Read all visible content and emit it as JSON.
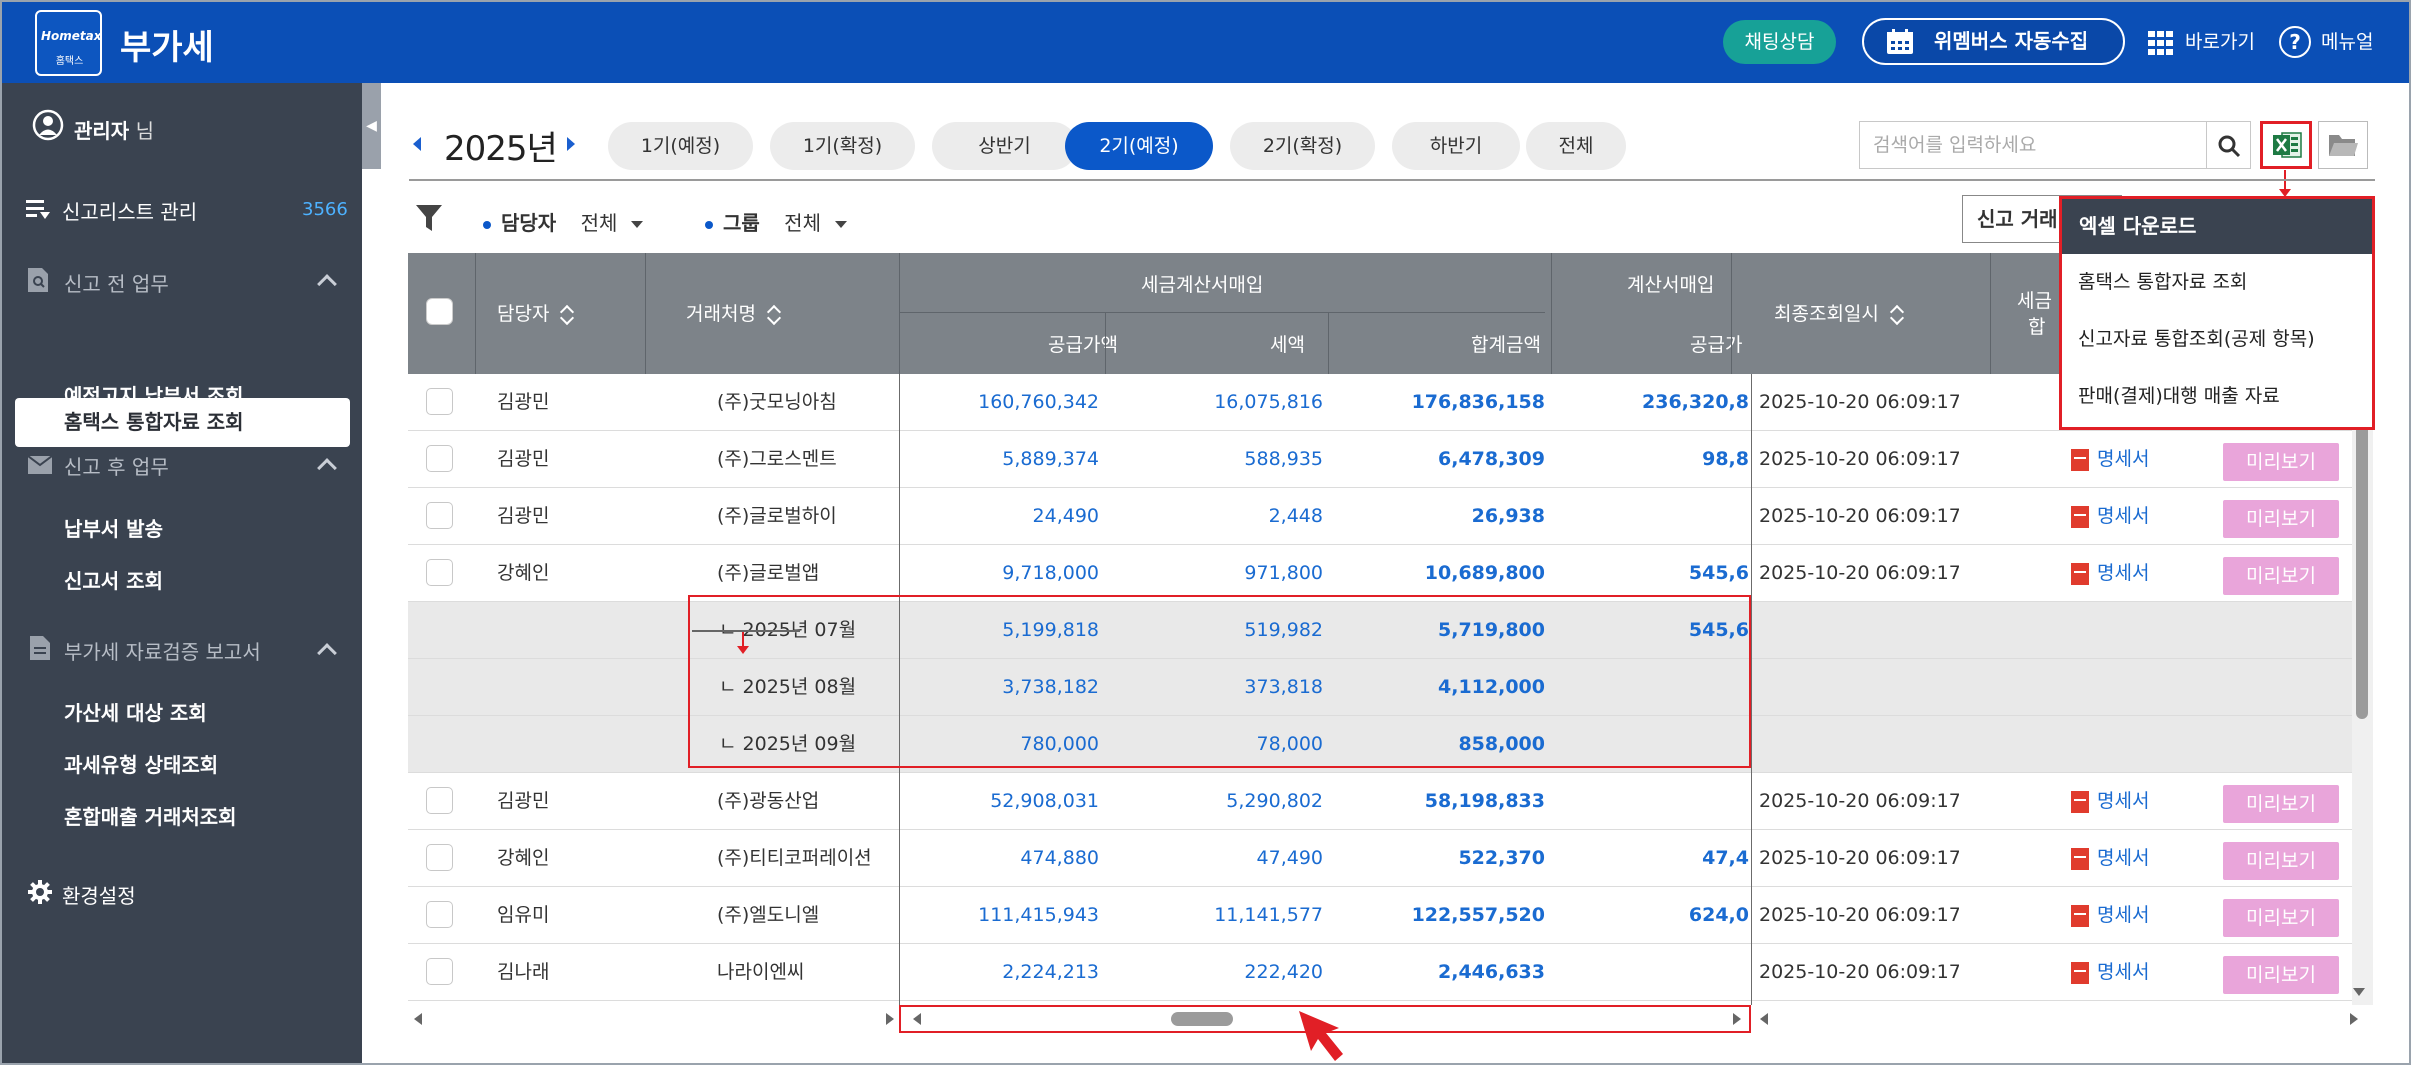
{
  "header": {
    "logo_line1": "Hometax",
    "logo_line2": "홈택스",
    "title": "부가세",
    "chat_label": "채팅상담",
    "wemake_label": "위멤버스 자동수집",
    "shortcut_label": "바로가기",
    "menu_label": "메뉴얼",
    "help_glyph": "?"
  },
  "sidebar": {
    "user_name": "관리자",
    "user_suffix": "님",
    "report_list": {
      "label": "신고리스트 관리",
      "count": "3566"
    },
    "pre_section": "신고 전 업무",
    "pre_items": [
      "홈택스 통합자료 조회",
      "예정고지 납부서 조회"
    ],
    "post_section": "신고 후 업무",
    "post_items": [
      "납부서 발송",
      "신고서 조회"
    ],
    "verify_section": "부가세 자료검증 보고서",
    "verify_items": [
      "가산세 대상 조회",
      "과세유형 상태조회",
      "혼합매출 거래처조회"
    ],
    "settings": "환경설정",
    "collapse_glyph": "◀"
  },
  "toolbar": {
    "year": "2025년",
    "periods": [
      "1기(예정)",
      "1기(확정)",
      "상반기",
      "2기(예정)",
      "2기(확정)",
      "하반기",
      "전체"
    ],
    "active_period": "2기(예정)",
    "search_placeholder": "검색어를 입력하세요",
    "manager_label": "담당자",
    "manager_value": "전체",
    "group_label": "그룹",
    "group_value": "전체",
    "report_btn": "신고 거래"
  },
  "dropdown": {
    "title": "엑셀 다운로드",
    "items": [
      "홈택스 통합자료 조회",
      "신고자료 통합조회(공제 항목)",
      "판매(결제)대행 매출 자료"
    ]
  },
  "table": {
    "headers": {
      "manager": "담당자",
      "client": "거래처명",
      "tax_invoice_group": "세금계산서매입",
      "supply": "공급가액",
      "tax": "세액",
      "total": "합계금액",
      "invoice_group": "계산서매입",
      "invoice_supply": "공급가",
      "last_query": "최종조회일시",
      "tax_col_line1": "세금",
      "tax_col_line2": "합"
    },
    "rows": [
      {
        "type": "main",
        "manager": "김광민",
        "client": "(주)굿모닝아침",
        "supply": "160,760,342",
        "tax": "16,075,816",
        "total": "176,836,158",
        "inv": "236,320,8",
        "date": "2025-10-20 06:09:17",
        "doc": "",
        "preview": ""
      },
      {
        "type": "main",
        "manager": "김광민",
        "client": "(주)그로스멘트",
        "supply": "5,889,374",
        "tax": "588,935",
        "total": "6,478,309",
        "inv": "98,8",
        "date": "2025-10-20 06:09:17",
        "doc": "명세서",
        "preview": "미리보기"
      },
      {
        "type": "main",
        "manager": "김광민",
        "client": "(주)글로벌하이",
        "supply": "24,490",
        "tax": "2,448",
        "total": "26,938",
        "inv": "",
        "date": "2025-10-20 06:09:17",
        "doc": "명세서",
        "preview": "미리보기"
      },
      {
        "type": "main",
        "manager": "강혜인",
        "client": "(주)글로벌앱",
        "supply": "9,718,000",
        "tax": "971,800",
        "total": "10,689,800",
        "inv": "545,6",
        "date": "2025-10-20 06:09:17",
        "doc": "명세서",
        "preview": "미리보기"
      },
      {
        "type": "sub",
        "manager": "",
        "client": "ㄴ 2025년 07월",
        "supply": "5,199,818",
        "tax": "519,982",
        "total": "5,719,800",
        "inv": "545,6",
        "date": "",
        "doc": "",
        "preview": ""
      },
      {
        "type": "sub",
        "manager": "",
        "client": "ㄴ 2025년 08월",
        "supply": "3,738,182",
        "tax": "373,818",
        "total": "4,112,000",
        "inv": "",
        "date": "",
        "doc": "",
        "preview": ""
      },
      {
        "type": "sub",
        "manager": "",
        "client": "ㄴ 2025년 09월",
        "supply": "780,000",
        "tax": "78,000",
        "total": "858,000",
        "inv": "",
        "date": "",
        "doc": "",
        "preview": ""
      },
      {
        "type": "main",
        "manager": "김광민",
        "client": "(주)광동산업",
        "supply": "52,908,031",
        "tax": "5,290,802",
        "total": "58,198,833",
        "inv": "",
        "date": "2025-10-20 06:09:17",
        "doc": "명세서",
        "preview": "미리보기"
      },
      {
        "type": "main",
        "manager": "강혜인",
        "client": "(주)티티코퍼레이션",
        "supply": "474,880",
        "tax": "47,490",
        "total": "522,370",
        "inv": "47,4",
        "date": "2025-10-20 06:09:17",
        "doc": "명세서",
        "preview": "미리보기"
      },
      {
        "type": "main",
        "manager": "임유미",
        "client": "(주)엘도니엘",
        "supply": "111,415,943",
        "tax": "11,141,577",
        "total": "122,557,520",
        "inv": "624,0",
        "date": "2025-10-20 06:09:17",
        "doc": "명세서",
        "preview": "미리보기"
      },
      {
        "type": "main",
        "manager": "김나래",
        "client": "나라이엔씨",
        "supply": "2,224,213",
        "tax": "222,420",
        "total": "2,446,633",
        "inv": "",
        "date": "2025-10-20 06:09:17",
        "doc": "명세서",
        "preview": "미리보기"
      }
    ]
  },
  "colors": {
    "header_bg": "#0b4fb6",
    "sidebar_bg": "#3a4350",
    "accent": "#0b58c9",
    "highlight": "#e11f26",
    "preview_btn": "#e9a5da",
    "chat_btn": "#17a197"
  }
}
